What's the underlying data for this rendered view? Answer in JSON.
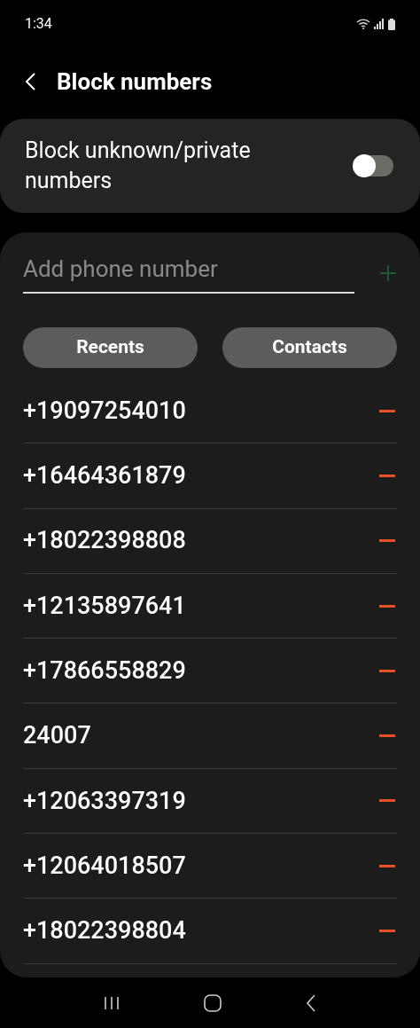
{
  "status_bar": {
    "time": "1:34"
  },
  "header": {
    "title": "Block numbers"
  },
  "block_unknown": {
    "label": "Block unknown/private numbers",
    "on": false
  },
  "add_field": {
    "placeholder": "Add phone number"
  },
  "buttons": [
    "Recents",
    "Contacts"
  ],
  "numbers": [
    {
      "number": "+19097254010"
    },
    {
      "number": "+16464361879"
    },
    {
      "number": "+18022398808"
    },
    {
      "number": "+12135897641"
    },
    {
      "number": "+17866558829"
    },
    {
      "number": "24007"
    },
    {
      "number": "+12063397319"
    },
    {
      "number": "+12064018507"
    },
    {
      "number": "+18022398804"
    }
  ]
}
